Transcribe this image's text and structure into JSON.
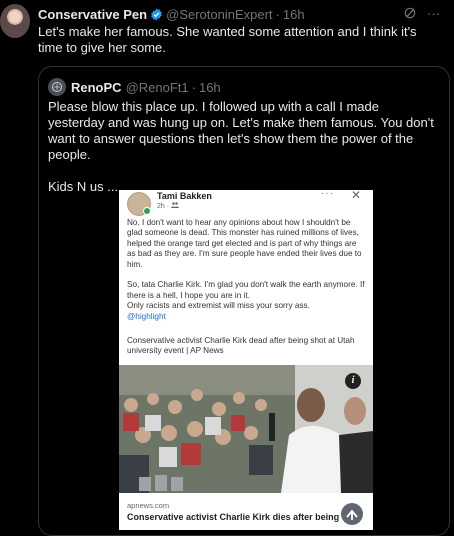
{
  "tweet": {
    "author_name": "Conservative Pen",
    "author_handle": "@SerotoninExpert",
    "time": "16h",
    "text": "Let's make her famous. She wanted some attention and I think it's time to give her some."
  },
  "quoted_tweet": {
    "author_name": "RenoPC",
    "author_handle": "@RenoFt1",
    "time": "16h",
    "text": "Please blow this place up. I followed up with a call I made yesterday and was hung up on. Let's make them famous. You don't want to answer questions then let's show them the power of the people.\n\nKids N us ...",
    "embedded_post": {
      "poster_name": "Tami Bakken",
      "post_time": "2h",
      "body": "No, I don't want to hear any opinions about how I shouldn't be glad someone is dead. This monster has ruined millions of lives, helped the orange tard get elected and is part of why things are as bad as they are. I'm sure people have ended their lives due to him.\n\nSo, tata Charlie Kirk. I'm glad you don't walk the earth anymore. If there is a hell, I hope you are in it.\nOnly racists and extremist will miss your sorry ass.",
      "mention": "@highlight",
      "headline": "Conservative activist Charlie Kirk dead after being shot at Utah university event | AP News",
      "link_domain": "apnews.com",
      "link_title": "Conservative activist Charlie Kirk dies after being"
    }
  },
  "colors": {
    "accent": "#1d9bf0",
    "muted": "#71767b",
    "link": "#216fdb"
  }
}
